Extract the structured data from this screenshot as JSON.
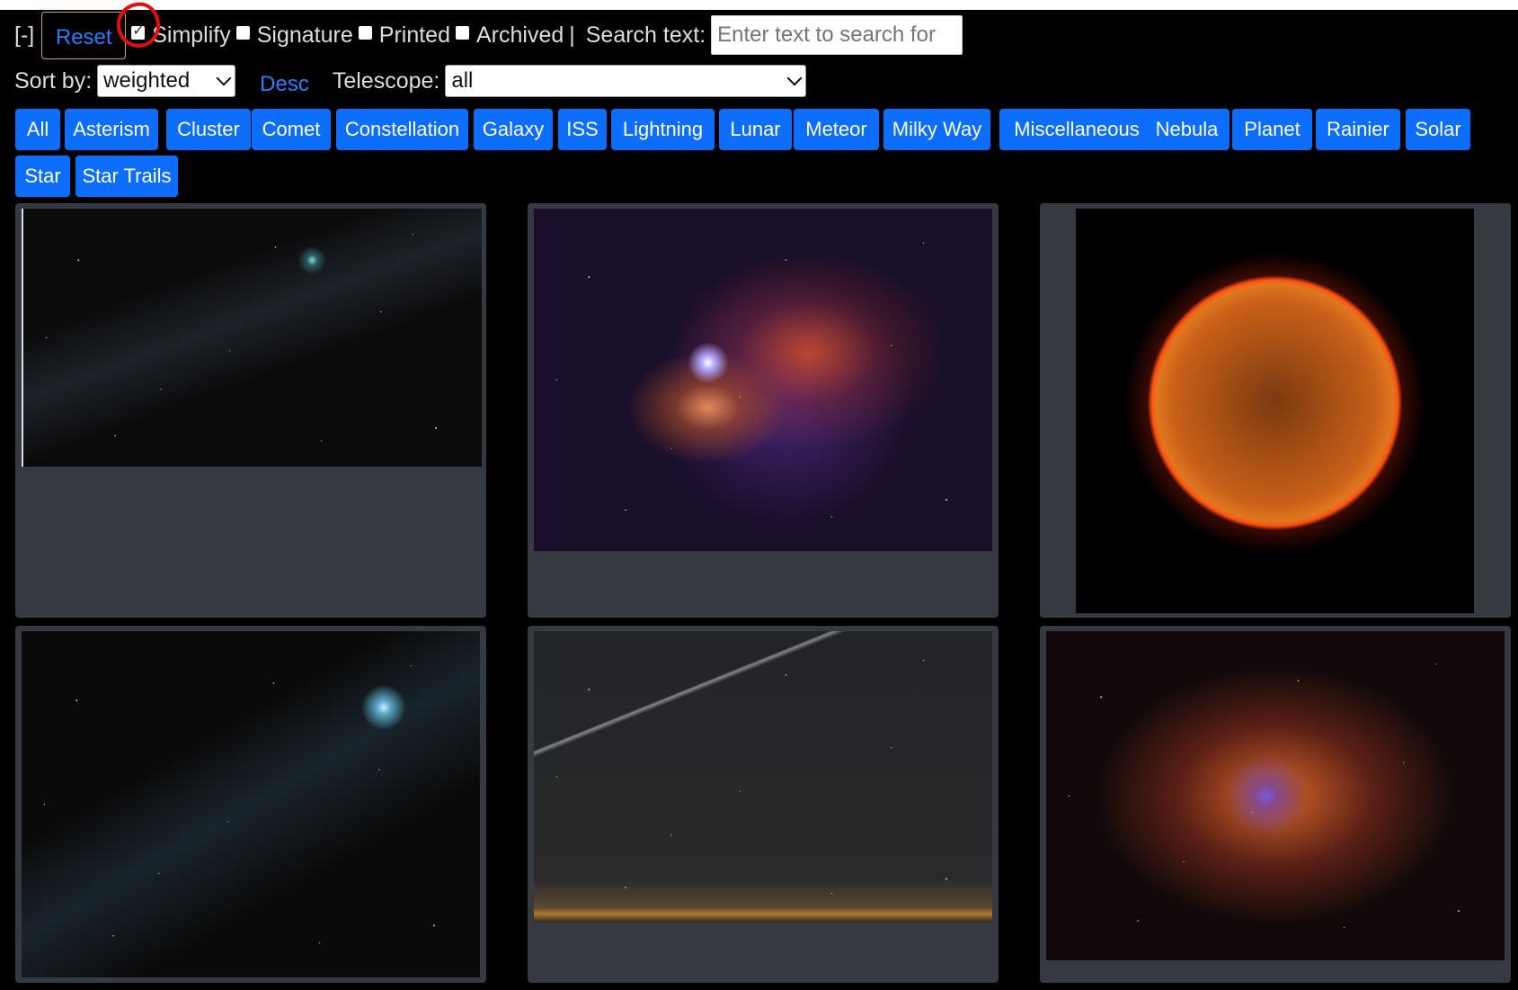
{
  "toolbar": {
    "collapse_label": "[-]",
    "reset_label": "Reset",
    "filters": [
      {
        "label": "Simplify",
        "checked": true
      },
      {
        "label": "Signature",
        "checked": false
      },
      {
        "label": "Printed",
        "checked": false
      },
      {
        "label": "Archived",
        "checked": false
      }
    ],
    "separator": "|",
    "search_label": "Search text:",
    "search_placeholder": "Enter text to search for",
    "sort_label": "Sort by:",
    "sort_value": "weighted",
    "order_label": "Desc",
    "telescope_label": "Telescope:",
    "telescope_value": "all"
  },
  "categories": [
    "All",
    "Asterism",
    "Cluster",
    "Comet",
    "Constellation",
    "Galaxy",
    "ISS",
    "Lightning",
    "Lunar",
    "Meteor",
    "Milky Way",
    "Miscellaneous",
    "Nebula",
    "Planet",
    "Rainier",
    "Solar",
    "Star",
    "Star Trails"
  ],
  "gallery": [
    {
      "subject": "comet-image"
    },
    {
      "subject": "horsehead-flame-nebula-image"
    },
    {
      "subject": "sun-image"
    },
    {
      "subject": "comet-image"
    },
    {
      "subject": "meteor-horizon-image"
    },
    {
      "subject": "heart-nebula-image"
    }
  ],
  "colors": {
    "accent": "#0d6efd",
    "link": "#2b7cff",
    "card": "#343a40",
    "annotation": "#e01010"
  }
}
